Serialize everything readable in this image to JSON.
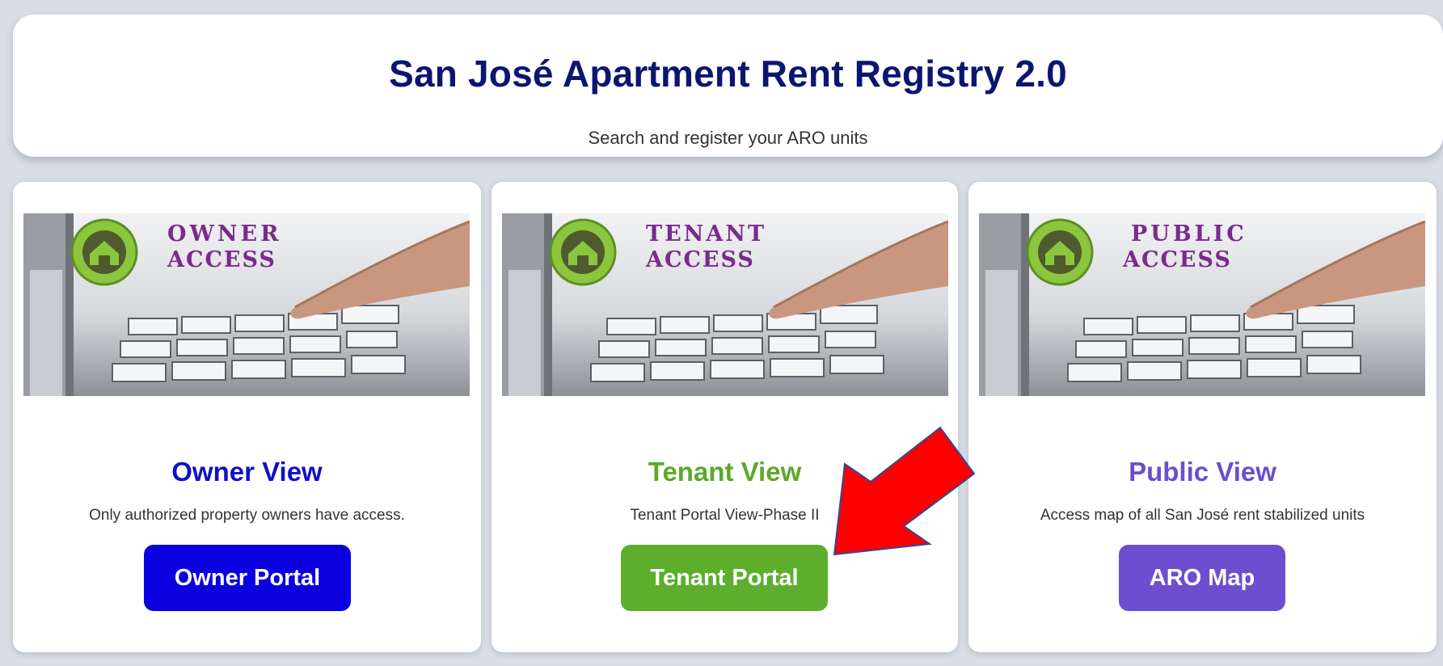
{
  "header": {
    "title": "San José Apartment Rent Registry 2.0",
    "subtitle": "Search and register your ARO units"
  },
  "cards": [
    {
      "banner_line1": "OWNER",
      "banner_line2": "ACCESS",
      "title": "Owner View",
      "title_color": "#1010c8",
      "description": "Only authorized property owners have access.",
      "button_label": "Owner Portal",
      "button_color": "#0a00e0"
    },
    {
      "banner_line1": "TENANT",
      "banner_line2": "ACCESS",
      "title": "Tenant View",
      "title_color": "#5da82a",
      "description": "Tenant Portal View-Phase II",
      "button_label": "Tenant Portal",
      "button_color": "#5cae2c"
    },
    {
      "banner_line1": "PUBLIC",
      "banner_line2": "ACCESS",
      "title": "Public View",
      "title_color": "#6a4fcc",
      "description": "Access map of all San José rent stabilized units",
      "button_label": "ARO Map",
      "button_color": "#6b4fd0"
    }
  ],
  "colors": {
    "page_background": "#d9dee5",
    "header_title": "#0c1670",
    "banner_text": "#7a2a8c",
    "banner_logo_green": "#8cc63f",
    "annotation_arrow_fill": "#ff0000",
    "annotation_arrow_stroke": "#2e4a9a"
  },
  "icons": {
    "banner_logo": "house-in-circle-icon",
    "annotation": "red-arrow-pointing-icon"
  }
}
